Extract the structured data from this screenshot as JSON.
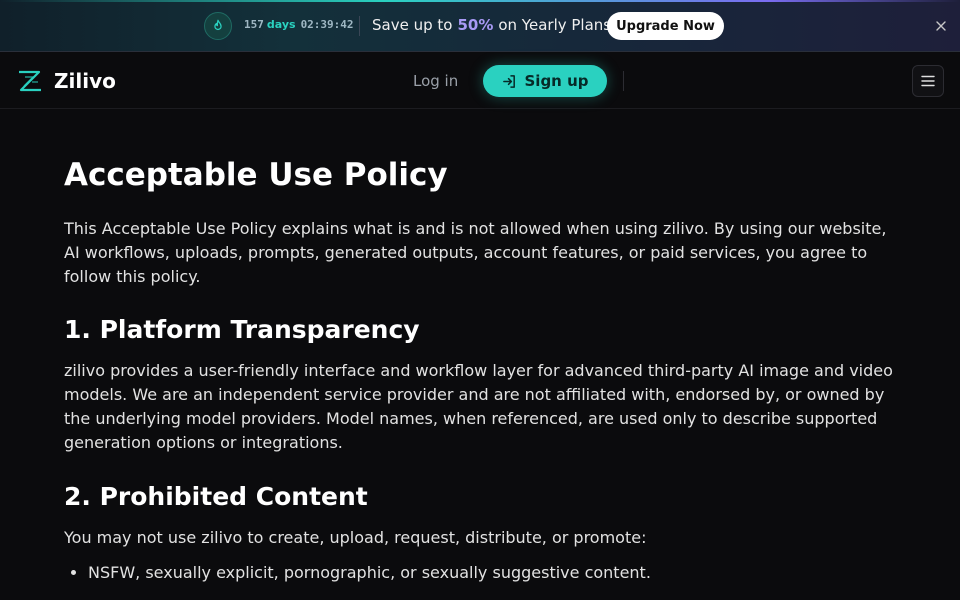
{
  "promo": {
    "icon": "flame-icon",
    "days": "157",
    "days_label": "days",
    "time": "02:39:42",
    "text_before": "Save up to",
    "percent": "50%",
    "text_after": "on Yearly Plans",
    "cta": "Upgrade Now",
    "close_icon": "close-icon"
  },
  "nav": {
    "brand": "Zilivo",
    "login": "Log in",
    "signup": "Sign up",
    "menu_icon": "☰"
  },
  "page": {
    "title": "Acceptable Use Policy",
    "intro": "This Acceptable Use Policy explains what is and is not allowed when using zilivo. By using our website, AI workflows, uploads, prompts, generated outputs, account features, or paid services, you agree to follow this policy.",
    "sections": [
      {
        "heading": "1. Platform Transparency",
        "body": "zilivo provides a user-friendly interface and workflow layer for advanced third-party AI image and video models. We are an independent service provider and are not affiliated with, endorsed by, or owned by the underlying model providers. Model names, when referenced, are used only to describe supported generation options or integrations."
      },
      {
        "heading": "2. Prohibited Content",
        "body": "You may not use zilivo to create, upload, request, distribute, or promote:",
        "items": [
          "NSFW, sexually explicit, pornographic, or sexually suggestive content."
        ]
      }
    ]
  },
  "colors": {
    "accent": "#2ad1c0",
    "promo_highlight": "#a89af5",
    "background": "#0b0b0d"
  }
}
